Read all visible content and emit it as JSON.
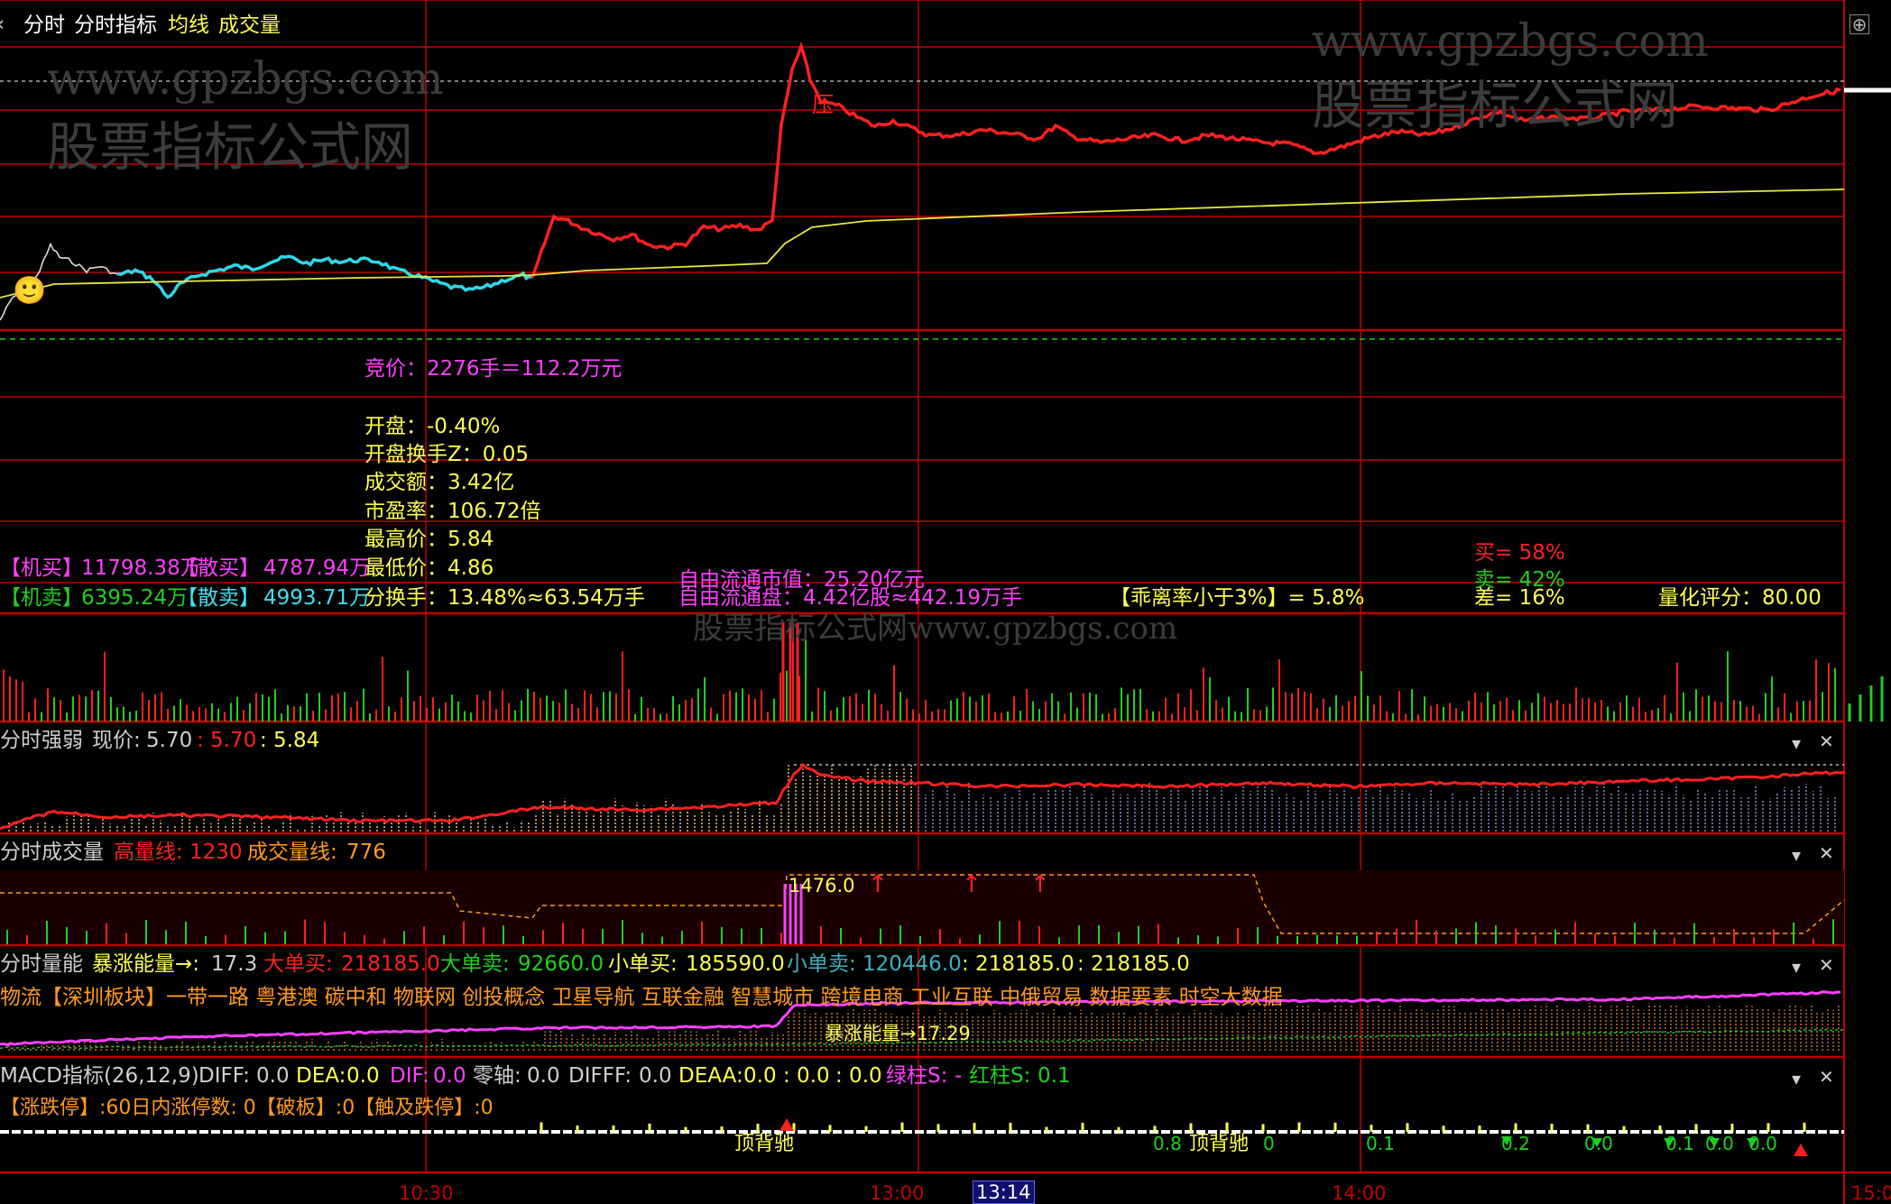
{
  "colors": {
    "bg": "#000000",
    "grid": "#c00000",
    "price_up": "#ff2020",
    "price_down": "#30d8e8",
    "avg_line": "#e8e840",
    "yellow": "#ffff55",
    "magenta": "#ff40ff",
    "green": "#20d020",
    "cyan": "#40e0f0",
    "white": "#ffffff",
    "orange": "#ff9a20"
  },
  "toolbar": {
    "back_icon": "chevron-left-icon",
    "tab_fenshi": "分时",
    "tab_fenshi_indicator": "分时指标",
    "tab_avg_line": "均线",
    "tab_volume": "成交量",
    "maximize_icon": "expand-icon"
  },
  "watermarks": {
    "url_top_left": "www.gpzbgs.com",
    "name_top_left": "股票指标公式网",
    "url_top_right": "www.gpzbgs.com",
    "name_top_right": "股票指标公式网",
    "mid_banner": "股票指标公式网www.gpzbgs.com"
  },
  "price_chart": {
    "resistance_marker": "压",
    "auction": "竞价：2276手＝112.2万元",
    "stats": [
      "开盘：-0.40%",
      "开盘换手Z：0.05",
      "成交额：3.42亿",
      "市盈率：106.72倍",
      "最高价：5.84",
      "最低价：4.86"
    ],
    "turnover": "分换手：13.48%≈63.54万手",
    "inst_buy_label": "【机买】",
    "inst_buy_value": "11798.38万",
    "retail_buy_label": "【散买】",
    "retail_buy_value": "4787.94万",
    "inst_sell_label": "【机卖】",
    "inst_sell_value": "6395.24万",
    "retail_sell_label": "【散卖】",
    "retail_sell_value": "4993.71万",
    "free_mktcap": "自由流通市值：25.20亿元",
    "free_float": "自由流通盘：4.42亿股≈442.19万手",
    "deviation": "【乖离率小于3%】= 5.8%",
    "buy_pct": "买= 58%",
    "sell_pct": "卖= 42%",
    "diff_pct": "差= 16%",
    "quant_score": "量化评分：80.00"
  },
  "panel_strength": {
    "title": "分时强弱",
    "price_label": "现价:",
    "price_value": "5.70",
    "v1": ": 5.70",
    "v2": ": 5.84"
  },
  "panel_volume": {
    "title": "分时成交量",
    "high_label": "高量线:",
    "high_value": "1230",
    "vol_label": "成交量线:",
    "vol_value": "776",
    "marker": "1476.0"
  },
  "panel_energy": {
    "title": "分时量能",
    "surge_label": "暴涨能量→:",
    "surge_value": "17.3",
    "big_buy_label": "大单买:",
    "big_buy_value": "218185.0",
    "big_sell_label": "大单卖:",
    "big_sell_value": "92660.0",
    "small_buy_label": "小单买:",
    "small_buy_value": "185590.0",
    "small_sell_label": "小单卖:",
    "small_sell_value": "120446.0",
    "v1": ": 218185.0",
    "v2": ": 218185.0",
    "concepts": "物流【深圳板块】一带一路 粤港澳 碳中和 物联网 创投概念 卫星导航 互联金融 智慧城市 跨境电商 工业互联 中俄贸易 数据要素 时空大数据",
    "surge_annotation": "暴涨能量→17.29"
  },
  "panel_macd": {
    "title": "MACD指标(26,12,9)",
    "diff_label": "DIFF:",
    "diff_value": "0.0",
    "dea_label": "DEA:",
    "dea_value": "0.0",
    "dif_label": "DIF:",
    "dif_value": "0.0",
    "zero_label": "零轴:",
    "zero_value": "0.0",
    "difff_label": "DIFFF:",
    "difff_value": "0.0",
    "deaa_label": "DEAA:",
    "deaa_value": "0.0",
    "v1": ": 0.0",
    "v2": ": 0.0",
    "green_bar_label": "绿柱S:",
    "green_bar_value": "-",
    "red_bar_label": "红柱S:",
    "red_bar_value": "0.1",
    "limit_text": "【涨跌停】:60日内涨停数: 0【破板】:0【触及跌停】:0",
    "divergence_1": "顶背驰",
    "divergence_2": "顶背驰",
    "bottom_values": [
      "0.8",
      "0",
      "0.1",
      "0.2",
      "0.0",
      "0.1",
      "0.0",
      "0.0"
    ]
  },
  "time_axis": {
    "labels": [
      "10:30",
      "13:00",
      "13:14",
      "14:00",
      "15:0"
    ]
  }
}
